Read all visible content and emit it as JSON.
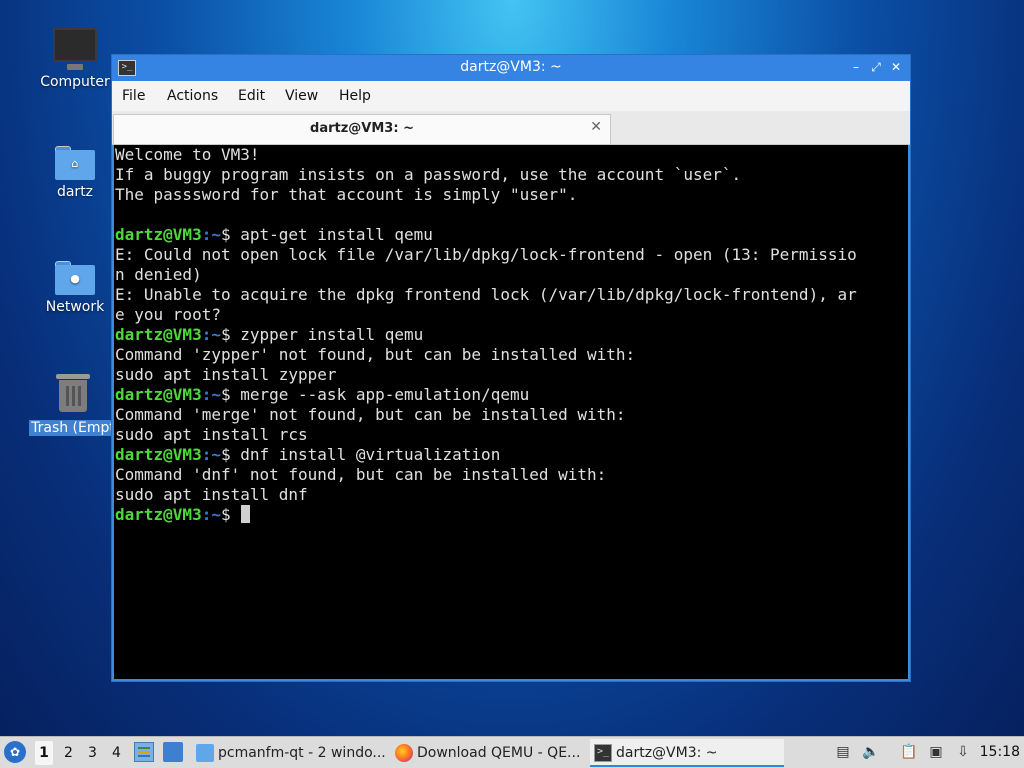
{
  "desktop": {
    "icons": [
      {
        "label": "Computer"
      },
      {
        "label": "dartz"
      },
      {
        "label": "Network"
      },
      {
        "label": "Trash (Empt"
      }
    ]
  },
  "window": {
    "title": "dartz@VM3: ~",
    "controls": {
      "minimize": "–",
      "restore": "⤢",
      "close": "✕"
    },
    "menu": [
      "File",
      "Actions",
      "Edit",
      "View",
      "Help"
    ],
    "tab": {
      "title": "dartz@VM3: ~",
      "close": "✕"
    }
  },
  "terminal": {
    "user_host": "dartz@VM3",
    "path": ":~",
    "prompt_symbol": "$ ",
    "lines": [
      {
        "type": "text",
        "text": "Welcome to VM3!"
      },
      {
        "type": "text",
        "text": "If a buggy program insists on a password, use the account `user`."
      },
      {
        "type": "text",
        "text": "The passsword for that account is simply \"user\"."
      },
      {
        "type": "text",
        "text": ""
      },
      {
        "type": "prompt",
        "text": "apt-get install qemu"
      },
      {
        "type": "text",
        "text": "E: Could not open lock file /var/lib/dpkg/lock-frontend - open (13: Permissio"
      },
      {
        "type": "text",
        "text": "n denied)"
      },
      {
        "type": "text",
        "text": "E: Unable to acquire the dpkg frontend lock (/var/lib/dpkg/lock-frontend), ar"
      },
      {
        "type": "text",
        "text": "e you root?"
      },
      {
        "type": "prompt",
        "text": "zypper install qemu"
      },
      {
        "type": "text",
        "text": "Command 'zypper' not found, but can be installed with:"
      },
      {
        "type": "text",
        "text": "sudo apt install zypper"
      },
      {
        "type": "prompt",
        "text": "merge --ask app-emulation/qemu"
      },
      {
        "type": "text",
        "text": "Command 'merge' not found, but can be installed with:"
      },
      {
        "type": "text",
        "text": "sudo apt install rcs"
      },
      {
        "type": "prompt",
        "text": "dnf install @virtualization"
      },
      {
        "type": "text",
        "text": "Command 'dnf' not found, but can be installed with:"
      },
      {
        "type": "text",
        "text": "sudo apt install dnf"
      },
      {
        "type": "prompt",
        "text": "",
        "cursor": true
      }
    ]
  },
  "taskbar": {
    "workspaces": [
      "1",
      "2",
      "3",
      "4"
    ],
    "active_workspace": "1",
    "tasks": [
      {
        "label": "pcmanfm-qt - 2 windo..."
      },
      {
        "label": "Download QEMU - QE..."
      },
      {
        "label": "dartz@VM3: ~"
      }
    ],
    "clock": "15:18"
  }
}
